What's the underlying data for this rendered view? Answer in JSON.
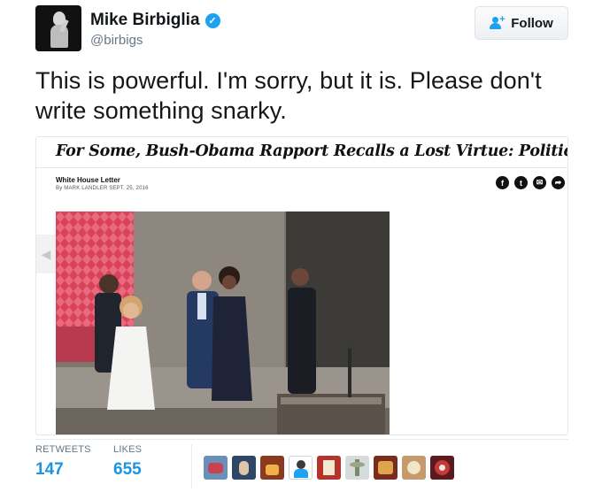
{
  "user": {
    "display_name": "Mike Birbiglia",
    "handle": "@birbigs",
    "verified_icon": "verified-badge-icon",
    "verified_color": "#1da1f2"
  },
  "follow": {
    "label": "Follow",
    "icon": "add-user-icon"
  },
  "tweet": {
    "text": "This is powerful. I'm sorry, but it is. Please don't write something snarky."
  },
  "article": {
    "headline": "For Some, Bush-Obama Rapport Recalls a Lost Virtue: Political Civility",
    "section": "White House Letter",
    "byline": "By MARK LANDLER   SEPT. 25, 2016",
    "share_icons": [
      "facebook-icon",
      "twitter-icon",
      "email-icon",
      "share-icon"
    ],
    "share_glyphs": [
      "f",
      "t",
      "✉",
      "➦"
    ],
    "prev_arrow": "◀"
  },
  "stats": {
    "retweets_label": "RETWEETS",
    "retweets_value": "147",
    "likes_label": "LIKES",
    "likes_value": "655"
  },
  "colors": {
    "link_blue": "#1b95e0",
    "muted_gray": "#657786"
  }
}
